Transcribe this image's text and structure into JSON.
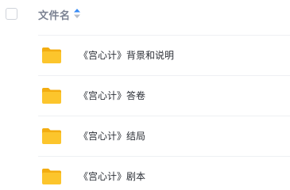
{
  "header": {
    "column_title": "文件名",
    "sort_icon": "sort-icon"
  },
  "files": [
    {
      "name": "《宫心计》背景和说明",
      "icon": "folder-icon"
    },
    {
      "name": "《宫心计》答卷",
      "icon": "folder-icon"
    },
    {
      "name": "《宫心计》结局",
      "icon": "folder-icon"
    },
    {
      "name": "《宫心计》剧本",
      "icon": "folder-icon"
    }
  ],
  "colors": {
    "folder": "#fcc52c",
    "folder_tab": "#f3ad11",
    "sort_active": "#3b8cf5",
    "sort_inactive": "#b8bdc7"
  }
}
